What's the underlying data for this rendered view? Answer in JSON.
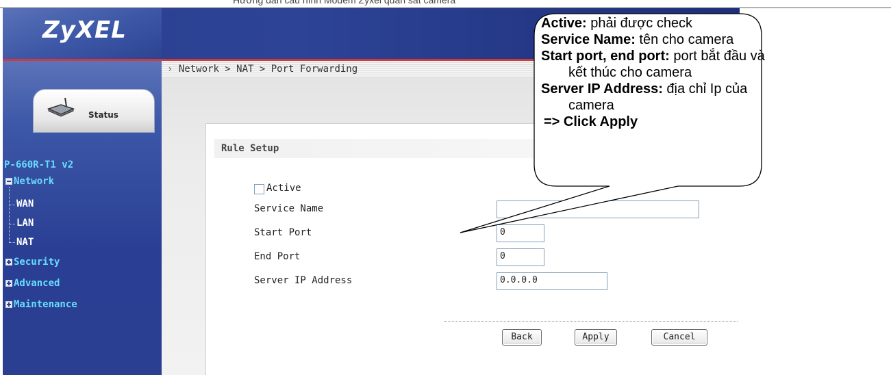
{
  "header_caption": "Hướng dẫn cấu hình Modem Zyxel quan sát camera",
  "brand": {
    "logo": "ZyXEL"
  },
  "sidebar": {
    "status_tab": "Status",
    "device": "P-660R-T1 v2",
    "items": [
      {
        "label": "Network",
        "icon": "minus-box-icon"
      },
      {
        "label": "WAN"
      },
      {
        "label": "LAN"
      },
      {
        "label": "NAT"
      },
      {
        "label": "Security",
        "icon": "plus-box-icon"
      },
      {
        "label": "Advanced",
        "icon": "plus-box-icon"
      },
      {
        "label": "Maintenance",
        "icon": "plus-box-icon"
      }
    ]
  },
  "breadcrumb": "Network > NAT > Port Forwarding",
  "form": {
    "title": "Rule Setup",
    "active_label": "Active",
    "active_checked": false,
    "service_name_label": "Service Name",
    "service_name_value": "",
    "start_port_label": "Start Port",
    "start_port_value": "0",
    "end_port_label": "End Port",
    "end_port_value": "0",
    "server_ip_label": "Server IP Address",
    "server_ip_value": "0.0.0.0"
  },
  "buttons": {
    "back": "Back",
    "apply": "Apply",
    "cancel": "Cancel"
  },
  "callout": {
    "l1_b": "Active:",
    "l1_t": " phải được check",
    "l2_b": "Service Name:",
    "l2_t": " tên cho camera",
    "l3_b": "Start port, end port:",
    "l3_t": " port bắt đầu và",
    "l4_t": "kết thúc cho camera",
    "l5_b": "Server IP Address:",
    "l5_t": " địa chỉ Ip của",
    "l6_t": "camera",
    "l7_b": "=> Click Apply"
  },
  "colors": {
    "sidebar_link": "#66ddff",
    "header_blue": "#2d4396",
    "accent_red": "#d23a3a"
  }
}
